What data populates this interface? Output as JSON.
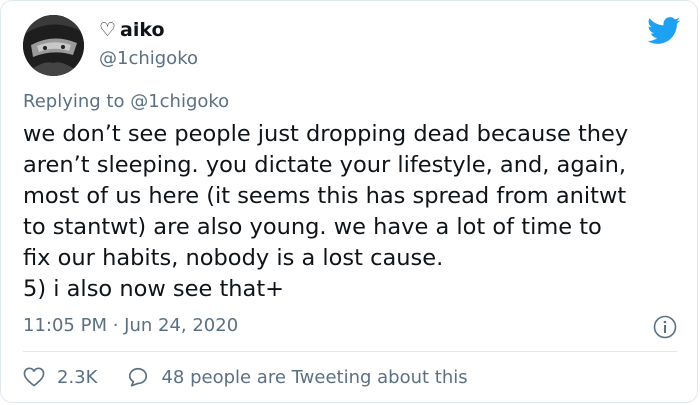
{
  "tweet": {
    "user": {
      "heart": "♡",
      "display_name": "aiko",
      "handle": "@1chigoko"
    },
    "reply": {
      "prefix": "Replying to ",
      "mention": "@1chigoko"
    },
    "text": "we don’t see people just dropping dead because they\naren’t sleeping. you dictate your lifestyle, and, again,\nmost of us here (it seems this has spread from anitwt\nto stantwt) are also young. we have a lot of time to\nfix our habits, nobody is a lost cause.\n5) i also now see that+",
    "timestamp": "11:05 PM · Jun 24, 2020",
    "likes": "2.3K",
    "conversation": "48 people are Tweeting about this"
  },
  "icons": {
    "brand": "twitter-bird-icon",
    "info": "info-icon",
    "like": "heart-outline-icon",
    "reply": "speech-bubble-icon"
  },
  "colors": {
    "brand": "#1DA1F2",
    "secondary_text": "#5B7083",
    "primary_text": "#0F1419",
    "divider": "#E1E8ED"
  }
}
